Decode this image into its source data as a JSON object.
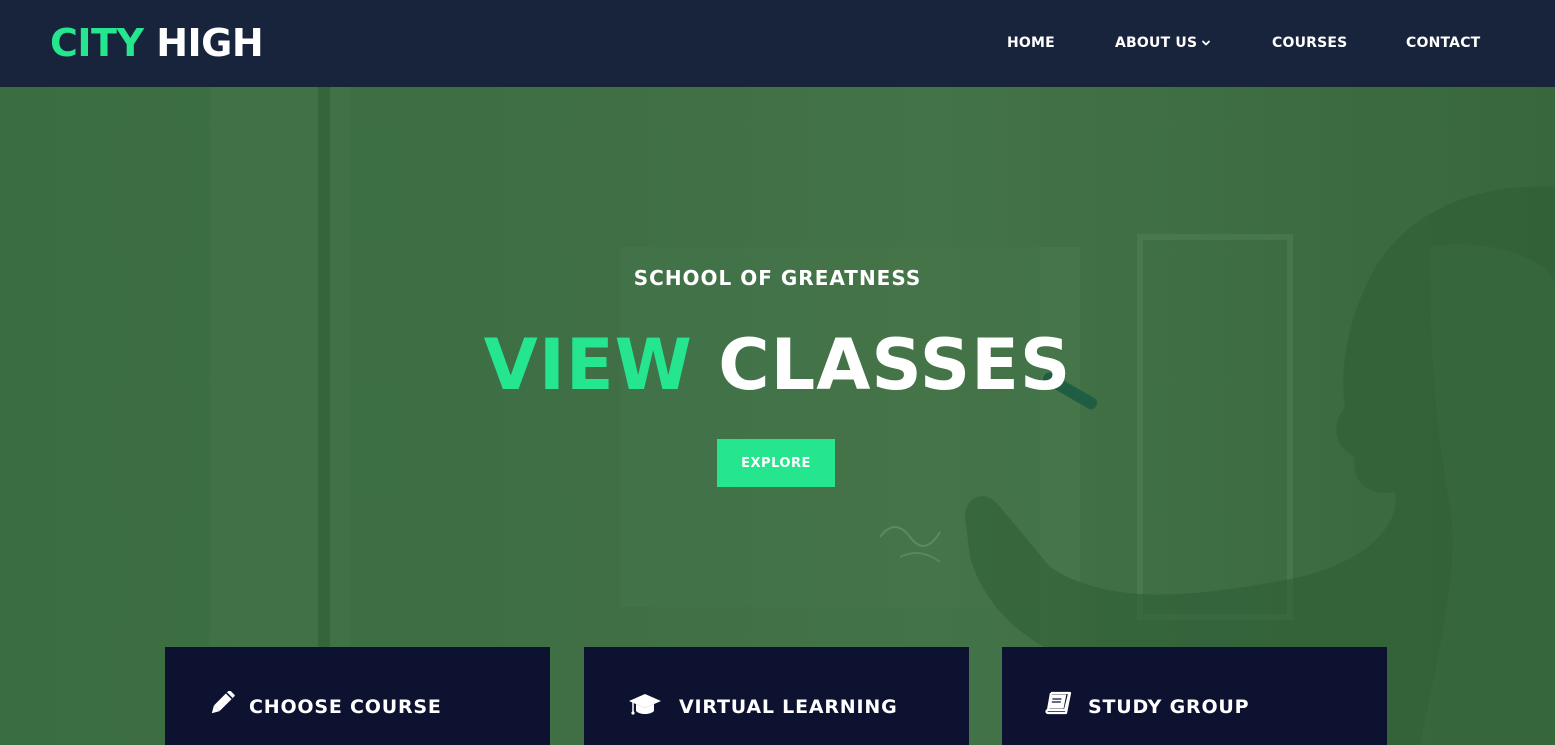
{
  "header": {
    "logo_accent": "CITY",
    "logo_rest": "HIGH",
    "nav": [
      {
        "label": "HOME"
      },
      {
        "label": "ABOUT US"
      },
      {
        "label": "COURSES"
      },
      {
        "label": "CONTACT"
      }
    ]
  },
  "hero": {
    "tagline": "SCHOOL OF GREATNESS",
    "headline_accent": "VIEW",
    "headline_rest": "CLASSES",
    "button_label": "EXPLORE"
  },
  "features": [
    {
      "title": "CHOOSE COURSE",
      "icon": "pencil-icon"
    },
    {
      "title": "VIRTUAL LEARNING",
      "icon": "graduation-cap-icon"
    },
    {
      "title": "STUDY GROUP",
      "icon": "book-icon"
    }
  ],
  "colors": {
    "header_bg": "#18243b",
    "accent": "#25e58f",
    "hero_tint": "#446f48",
    "card_bg": "#0d1230"
  }
}
